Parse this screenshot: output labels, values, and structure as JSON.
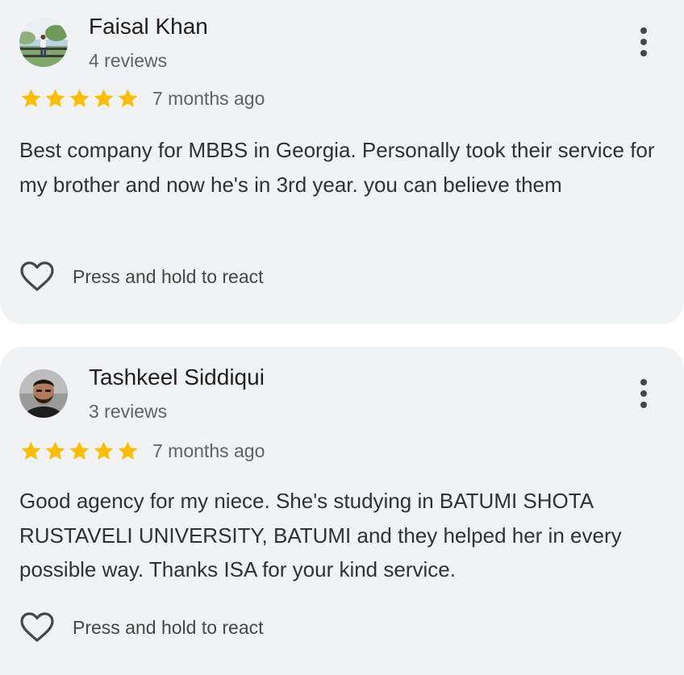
{
  "reviews": [
    {
      "author": "Faisal Khan",
      "review_count": "4 reviews",
      "rating": 5,
      "time_ago": "7 months ago",
      "text": "Best company for MBBS in Georgia. Personally took their service for my brother and now he's in 3rd year. you can believe them",
      "react_label": "Press and hold to react",
      "avatar_icon": "landscape-photo-avatar"
    },
    {
      "author": "Tashkeel Siddiqui",
      "review_count": "3 reviews",
      "rating": 5,
      "time_ago": "7 months ago",
      "text": "Good agency for my niece. She's studying in BATUMI SHOTA RUSTAVELI UNIVERSITY, BATUMI and they helped her in every possible way. Thanks ISA for your kind service.",
      "react_label": "Press and hold to react",
      "avatar_icon": "portrait-photo-avatar"
    }
  ],
  "colors": {
    "card_bg": "#f0f2f4",
    "star": "#fbbc04",
    "name_text": "#1f1f1f",
    "meta_text": "#5f6368",
    "body_text": "#303134"
  },
  "icons": {
    "star": "star-icon",
    "more": "more-vert-icon",
    "react": "heart-outline-icon"
  }
}
